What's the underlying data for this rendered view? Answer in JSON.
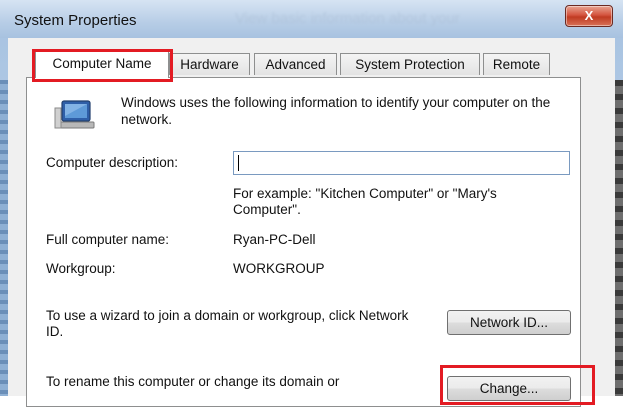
{
  "window": {
    "title": "System Properties",
    "background_title": "View basic information about your",
    "close_label": "X"
  },
  "tabs": [
    {
      "label": "Computer Name",
      "active": true
    },
    {
      "label": "Hardware",
      "active": false
    },
    {
      "label": "Advanced",
      "active": false
    },
    {
      "label": "System Protection",
      "active": false
    },
    {
      "label": "Remote",
      "active": false
    }
  ],
  "computer_name_tab": {
    "info_text": "Windows uses the following information to identify your computer on the network.",
    "description_label": "Computer description:",
    "description_value": "",
    "example_text": "For example: \"Kitchen Computer\" or \"Mary's Computer\".",
    "full_name_label": "Full computer name:",
    "full_name_value": "Ryan-PC-Dell",
    "workgroup_label": "Workgroup:",
    "workgroup_value": "WORKGROUP",
    "network_id_text": "To use a wizard to join a domain or workgroup, click Network ID.",
    "network_id_button": "Network ID...",
    "rename_text": "To rename this computer or change its domain or",
    "change_button": "Change..."
  },
  "colors": {
    "highlight": "#e31b23",
    "titlebar": "#b7cde6",
    "close_button": "#c03b22"
  },
  "icons": [
    "computer-network-icon",
    "close-icon"
  ]
}
